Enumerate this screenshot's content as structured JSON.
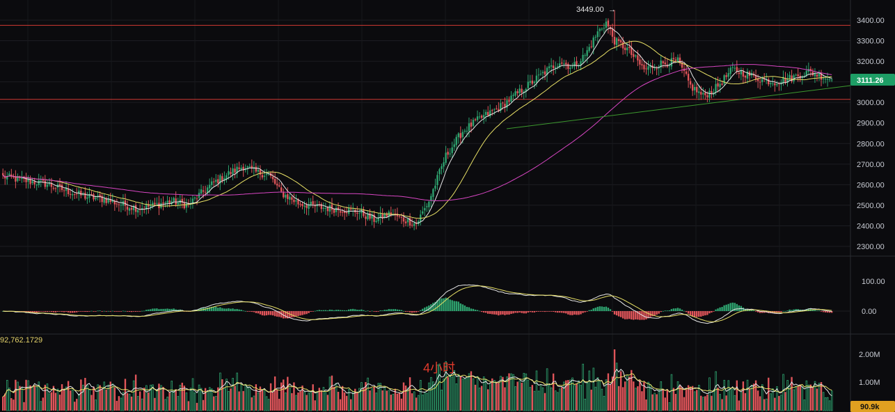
{
  "chart_data": {
    "type": "candlestick",
    "timeframe_label": "4小时",
    "price_axis": {
      "ticks": [
        "3400.00",
        "3300.00",
        "3200.00",
        "3100.00",
        "3000.00",
        "2900.00",
        "2800.00",
        "2700.00",
        "2600.00",
        "2500.00",
        "2400.00",
        "2300.00"
      ],
      "range": [
        2250,
        3500
      ]
    },
    "high_label": "3449.00",
    "current_price": "3111.26",
    "support_resistance": [
      3375,
      3015
    ],
    "macd_axis": {
      "ticks": [
        "100.00",
        "0.00"
      ]
    },
    "volume_axis": {
      "ticks": [
        "2.00M",
        "1.00M"
      ]
    },
    "volume_value_label": "92,762.1729",
    "volume_current": "90.9k",
    "colors": {
      "up": "#2ea36f",
      "down": "#e0555a",
      "ma_fast": "#e8e8e8",
      "ma_slow": "#e8e066",
      "ma_long": "#d946c4",
      "trend": "#3d9a2f",
      "level_line": "#d23a33",
      "price_badge": "#1e9e66",
      "volume_badge": "#e0a020"
    },
    "close_anchors": [
      [
        0,
        2640
      ],
      [
        10,
        2620
      ],
      [
        20,
        2605
      ],
      [
        30,
        2570
      ],
      [
        40,
        2540
      ],
      [
        48,
        2530
      ],
      [
        56,
        2505
      ],
      [
        64,
        2485
      ],
      [
        72,
        2500
      ],
      [
        80,
        2520
      ],
      [
        88,
        2500
      ],
      [
        92,
        2540
      ],
      [
        100,
        2610
      ],
      [
        108,
        2660
      ],
      [
        114,
        2690
      ],
      [
        120,
        2660
      ],
      [
        126,
        2650
      ],
      [
        132,
        2560
      ],
      [
        140,
        2510
      ],
      [
        150,
        2490
      ],
      [
        160,
        2480
      ],
      [
        168,
        2470
      ],
      [
        176,
        2430
      ],
      [
        184,
        2460
      ],
      [
        190,
        2430
      ],
      [
        196,
        2410
      ],
      [
        202,
        2520
      ],
      [
        210,
        2740
      ],
      [
        218,
        2860
      ],
      [
        226,
        2920
      ],
      [
        236,
        2980
      ],
      [
        246,
        3060
      ],
      [
        256,
        3140
      ],
      [
        264,
        3200
      ],
      [
        270,
        3170
      ],
      [
        276,
        3230
      ],
      [
        282,
        3340
      ],
      [
        286,
        3390
      ],
      [
        290,
        3300
      ],
      [
        296,
        3260
      ],
      [
        304,
        3160
      ],
      [
        312,
        3190
      ],
      [
        320,
        3200
      ],
      [
        326,
        3080
      ],
      [
        332,
        3030
      ],
      [
        338,
        3070
      ],
      [
        346,
        3160
      ],
      [
        352,
        3140
      ],
      [
        360,
        3110
      ],
      [
        366,
        3100
      ],
      [
        374,
        3120
      ],
      [
        382,
        3150
      ],
      [
        388,
        3130
      ],
      [
        393,
        3111
      ]
    ]
  }
}
